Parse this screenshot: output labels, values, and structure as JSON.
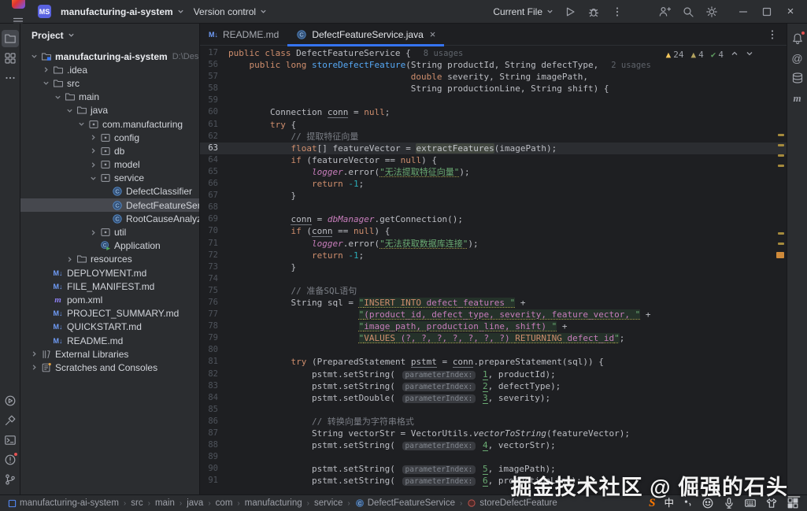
{
  "titlebar": {
    "project_badge": "MS",
    "project_name": "manufacturing-ai-system",
    "vcs_label": "Version control",
    "run_config": "Current File",
    "left_icons": [
      "app-logo",
      "main-menu"
    ],
    "run_icons": [
      "play",
      "debug",
      "more-vertical"
    ],
    "right_icons": [
      "add-user",
      "search",
      "settings"
    ],
    "window_icons": [
      "minimize",
      "maximize",
      "close"
    ]
  },
  "stripes": {
    "left_top": [
      {
        "name": "project-folder",
        "active": true
      },
      {
        "name": "structure",
        "active": false
      },
      {
        "name": "more",
        "active": false
      }
    ],
    "left_bottom": [
      {
        "name": "run",
        "badge": false
      },
      {
        "name": "build",
        "badge": false
      },
      {
        "name": "terminal",
        "badge": false
      },
      {
        "name": "problems",
        "badge": true
      },
      {
        "name": "git-branch",
        "badge": false
      }
    ],
    "right_top": [
      {
        "name": "notifications",
        "badge": true
      },
      {
        "name": "ai-assistant",
        "badge": false
      },
      {
        "name": "database",
        "badge": false
      },
      {
        "name": "maven",
        "badge": false
      }
    ]
  },
  "project_panel": {
    "title": "Project",
    "tree": [
      {
        "d": 0,
        "c": "v",
        "i": "project-root",
        "label": "manufacturing-ai-system",
        "extra": "D:\\Desktop\\openG",
        "bold": true
      },
      {
        "d": 1,
        "c": ">",
        "i": "folder",
        "label": ".idea"
      },
      {
        "d": 1,
        "c": "v",
        "i": "folder",
        "label": "src"
      },
      {
        "d": 2,
        "c": "v",
        "i": "folder",
        "label": "main"
      },
      {
        "d": 3,
        "c": "v",
        "i": "folder",
        "label": "java"
      },
      {
        "d": 4,
        "c": "v",
        "i": "package",
        "label": "com.manufacturing"
      },
      {
        "d": 5,
        "c": ">",
        "i": "package",
        "label": "config"
      },
      {
        "d": 5,
        "c": ">",
        "i": "package",
        "label": "db"
      },
      {
        "d": 5,
        "c": ">",
        "i": "package",
        "label": "model"
      },
      {
        "d": 5,
        "c": "v",
        "i": "package",
        "label": "service"
      },
      {
        "d": 6,
        "c": null,
        "i": "class",
        "label": "DefectClassifier"
      },
      {
        "d": 6,
        "c": null,
        "i": "class",
        "label": "DefectFeatureService",
        "sel": true
      },
      {
        "d": 6,
        "c": null,
        "i": "class",
        "label": "RootCauseAnalyzer"
      },
      {
        "d": 5,
        "c": ">",
        "i": "package",
        "label": "util"
      },
      {
        "d": 5,
        "c": null,
        "i": "class-run",
        "label": "Application"
      },
      {
        "d": 3,
        "c": ">",
        "i": "folder",
        "label": "resources"
      },
      {
        "d": 1,
        "c": null,
        "i": "markdown",
        "label": "DEPLOYMENT.md"
      },
      {
        "d": 1,
        "c": null,
        "i": "markdown",
        "label": "FILE_MANIFEST.md"
      },
      {
        "d": 1,
        "c": null,
        "i": "maven-file",
        "label": "pom.xml"
      },
      {
        "d": 1,
        "c": null,
        "i": "markdown",
        "label": "PROJECT_SUMMARY.md"
      },
      {
        "d": 1,
        "c": null,
        "i": "markdown",
        "label": "QUICKSTART.md"
      },
      {
        "d": 1,
        "c": null,
        "i": "markdown",
        "label": "README.md"
      },
      {
        "d": 0,
        "c": ">",
        "i": "library",
        "label": "External Libraries"
      },
      {
        "d": 0,
        "c": ">",
        "i": "scratches",
        "label": "Scratches and Consoles"
      }
    ]
  },
  "tabs": [
    {
      "label": "README.md",
      "icon": "markdown",
      "active": false
    },
    {
      "label": "DefectFeatureService.java",
      "icon": "class",
      "active": true,
      "closable": true
    }
  ],
  "inspections": {
    "items": [
      {
        "icon": "warning",
        "count": "24",
        "color": "#f2c55c"
      },
      {
        "icon": "weak-warning",
        "count": "4",
        "color": "#b3a25f"
      },
      {
        "icon": "ok",
        "count": "4",
        "color": "#5d9b5f"
      }
    ],
    "nav_icons": [
      "prev-problem",
      "next-problem"
    ]
  },
  "editor": {
    "lines": [
      {
        "n": "17",
        "t": [
          [
            "kw",
            "public class "
          ],
          [
            "d",
            "DefectFeatureService"
          ],
          [
            "d",
            " {"
          ],
          [
            "u",
            "8 usages"
          ]
        ]
      },
      {
        "n": "56",
        "t": [
          [
            "d",
            "    "
          ],
          [
            "kw",
            "public long "
          ],
          [
            "md",
            "storeDefectFeature"
          ],
          [
            "d",
            "(String productId, String defectType,"
          ],
          [
            "u",
            "2 usages"
          ]
        ]
      },
      {
        "n": "57",
        "t": [
          [
            "d",
            "                                   "
          ],
          [
            "kw",
            "double"
          ],
          [
            "d",
            " severity, String imagePath,"
          ]
        ]
      },
      {
        "n": "58",
        "t": [
          [
            "d",
            "                                   String productionLine, String shift) {"
          ]
        ]
      },
      {
        "n": "59",
        "t": []
      },
      {
        "n": "60",
        "t": [
          [
            "d",
            "        Connection "
          ],
          [
            "un",
            "conn"
          ],
          [
            "d",
            " = "
          ],
          [
            "kw",
            "null"
          ],
          [
            "d",
            ";"
          ]
        ]
      },
      {
        "n": "61",
        "t": [
          [
            "d",
            "        "
          ],
          [
            "kw",
            "try"
          ],
          [
            "d",
            " {"
          ]
        ]
      },
      {
        "n": "62",
        "t": [
          [
            "d",
            "            "
          ],
          [
            "c",
            "// 提取特征向量"
          ]
        ]
      },
      {
        "n": "63",
        "cur": true,
        "t": [
          [
            "d",
            "            "
          ],
          [
            "kw",
            "float"
          ],
          [
            "d",
            "[] featureVector = "
          ],
          [
            "hl",
            "extractFeatures"
          ],
          [
            "d",
            "(imagePath);"
          ]
        ]
      },
      {
        "n": "64",
        "t": [
          [
            "d",
            "            "
          ],
          [
            "kw",
            "if"
          ],
          [
            "d",
            " (featureVector == "
          ],
          [
            "kw",
            "null"
          ],
          [
            "d",
            ") {"
          ]
        ]
      },
      {
        "n": "65",
        "t": [
          [
            "d",
            "                "
          ],
          [
            "f",
            "logger"
          ],
          [
            "d",
            ".error("
          ],
          [
            "sw",
            "\"无法提取特征向量\""
          ],
          [
            "d",
            ");"
          ]
        ]
      },
      {
        "n": "66",
        "t": [
          [
            "d",
            "                "
          ],
          [
            "kw",
            "return "
          ],
          [
            "num",
            "-1"
          ],
          [
            "d",
            ";"
          ]
        ]
      },
      {
        "n": "67",
        "t": [
          [
            "d",
            "            }"
          ]
        ]
      },
      {
        "n": "68",
        "t": []
      },
      {
        "n": "69",
        "t": [
          [
            "d",
            "            "
          ],
          [
            "un",
            "conn"
          ],
          [
            "d",
            " = "
          ],
          [
            "f",
            "dbManager"
          ],
          [
            "d",
            ".getConnection();"
          ]
        ]
      },
      {
        "n": "70",
        "t": [
          [
            "d",
            "            "
          ],
          [
            "kw",
            "if"
          ],
          [
            "d",
            " ("
          ],
          [
            "un",
            "conn"
          ],
          [
            "d",
            " == "
          ],
          [
            "kw",
            "null"
          ],
          [
            "d",
            ") {"
          ]
        ]
      },
      {
        "n": "71",
        "t": [
          [
            "d",
            "                "
          ],
          [
            "f",
            "logger"
          ],
          [
            "d",
            ".error("
          ],
          [
            "sw",
            "\"无法获取数据库连接\""
          ],
          [
            "d",
            ");"
          ]
        ]
      },
      {
        "n": "72",
        "t": [
          [
            "d",
            "                "
          ],
          [
            "kw",
            "return "
          ],
          [
            "num",
            "-1"
          ],
          [
            "d",
            ";"
          ]
        ]
      },
      {
        "n": "73",
        "t": [
          [
            "d",
            "            }"
          ]
        ]
      },
      {
        "n": "74",
        "t": []
      },
      {
        "n": "75",
        "t": [
          [
            "d",
            "            "
          ],
          [
            "c",
            "// 准备SQL语句"
          ]
        ]
      },
      {
        "n": "76",
        "t": [
          [
            "d",
            "            String sql = "
          ],
          [
            "sq",
            "\""
          ],
          [
            "sk",
            "INSERT INTO"
          ],
          [
            "si",
            " defect_features "
          ],
          [
            "sq",
            "\""
          ],
          [
            "d",
            " +"
          ]
        ]
      },
      {
        "n": "77",
        "t": [
          [
            "d",
            "                         "
          ],
          [
            "sq",
            "\""
          ],
          [
            "si",
            "(product_id, defect_type, severity, feature_vector, "
          ],
          [
            "sq",
            "\""
          ],
          [
            "d",
            " +"
          ]
        ]
      },
      {
        "n": "78",
        "t": [
          [
            "d",
            "                         "
          ],
          [
            "sq",
            "\""
          ],
          [
            "si",
            "image_path, production_line, shift) "
          ],
          [
            "sq",
            "\""
          ],
          [
            "d",
            " +"
          ]
        ]
      },
      {
        "n": "79",
        "t": [
          [
            "d",
            "                         "
          ],
          [
            "sq",
            "\""
          ],
          [
            "sk",
            "VALUES"
          ],
          [
            "si",
            " (?, ?, ?, ?, ?, ?, ?) "
          ],
          [
            "sk",
            "RETURNING"
          ],
          [
            "si",
            " defect_id"
          ],
          [
            "sq",
            "\""
          ],
          [
            "d",
            ";"
          ]
        ]
      },
      {
        "n": "80",
        "t": []
      },
      {
        "n": "81",
        "t": [
          [
            "d",
            "            "
          ],
          [
            "kw",
            "try"
          ],
          [
            "d",
            " (PreparedStatement "
          ],
          [
            "un",
            "pstmt"
          ],
          [
            "d",
            " = "
          ],
          [
            "un",
            "conn"
          ],
          [
            "d",
            ".prepareStatement(sql)) {"
          ]
        ]
      },
      {
        "n": "82",
        "t": [
          [
            "d",
            "                pstmt.setString( "
          ],
          [
            "in",
            "parameterIndex:"
          ],
          [
            "d",
            " "
          ],
          [
            "pn",
            "1"
          ],
          [
            "d",
            ", productId);"
          ]
        ]
      },
      {
        "n": "83",
        "t": [
          [
            "d",
            "                pstmt.setString( "
          ],
          [
            "in",
            "parameterIndex:"
          ],
          [
            "d",
            " "
          ],
          [
            "pn",
            "2"
          ],
          [
            "d",
            ", defectType);"
          ]
        ]
      },
      {
        "n": "84",
        "t": [
          [
            "d",
            "                pstmt.setDouble( "
          ],
          [
            "in",
            "parameterIndex:"
          ],
          [
            "d",
            " "
          ],
          [
            "pn",
            "3"
          ],
          [
            "d",
            ", severity);"
          ]
        ]
      },
      {
        "n": "85",
        "t": []
      },
      {
        "n": "86",
        "t": [
          [
            "d",
            "                "
          ],
          [
            "c",
            "// 转换向量为字符串格式"
          ]
        ]
      },
      {
        "n": "87",
        "t": [
          [
            "d",
            "                String vectorStr = VectorUtils."
          ],
          [
            "it",
            "vectorToString"
          ],
          [
            "d",
            "(featureVector);"
          ]
        ]
      },
      {
        "n": "88",
        "t": [
          [
            "d",
            "                pstmt.setString( "
          ],
          [
            "in",
            "parameterIndex:"
          ],
          [
            "d",
            " "
          ],
          [
            "pn",
            "4"
          ],
          [
            "d",
            ", vectorStr);"
          ]
        ]
      },
      {
        "n": "89",
        "t": []
      },
      {
        "n": "90",
        "t": [
          [
            "d",
            "                pstmt.setString( "
          ],
          [
            "in",
            "parameterIndex:"
          ],
          [
            "d",
            " "
          ],
          [
            "pn",
            "5"
          ],
          [
            "d",
            ", imagePath);"
          ]
        ]
      },
      {
        "n": "91",
        "t": [
          [
            "d",
            "                pstmt.setString( "
          ],
          [
            "in",
            "parameterIndex:"
          ],
          [
            "d",
            " "
          ],
          [
            "pn",
            "6"
          ],
          [
            "d",
            ", productionLine);"
          ]
        ]
      }
    ],
    "scroll_marks": [
      {
        "t": 112,
        "w": 8,
        "h": 3,
        "c": "#a58a3c"
      },
      {
        "t": 125,
        "w": 8,
        "h": 3,
        "c": "#a58a3c"
      },
      {
        "t": 138,
        "w": 8,
        "h": 3,
        "c": "#a58a3c"
      },
      {
        "t": 151,
        "w": 8,
        "h": 3,
        "c": "#a58a3c"
      },
      {
        "t": 237,
        "w": 8,
        "h": 3,
        "c": "#a58a3c"
      },
      {
        "t": 250,
        "w": 8,
        "h": 3,
        "c": "#a58a3c"
      },
      {
        "t": 262,
        "w": 10,
        "h": 8,
        "c": "#cf8a3a"
      }
    ]
  },
  "watermark": "掘金技术社区 @ 倔强的石头_",
  "statusbar": {
    "breadcrumbs": [
      {
        "icon": "module",
        "label": "manufacturing-ai-system"
      },
      {
        "label": "src"
      },
      {
        "label": "main"
      },
      {
        "label": "java"
      },
      {
        "label": "com"
      },
      {
        "label": "manufacturing"
      },
      {
        "label": "service"
      },
      {
        "icon": "class-small",
        "label": "DefectFeatureService"
      },
      {
        "icon": "method",
        "label": "storeDefectFeature"
      }
    ],
    "tray_icons": [
      "sogou",
      "zh-mode",
      "ime-pointer",
      "emoji",
      "mic",
      "soft-keyboard",
      "ime-skin",
      "ime-toolbox"
    ]
  }
}
